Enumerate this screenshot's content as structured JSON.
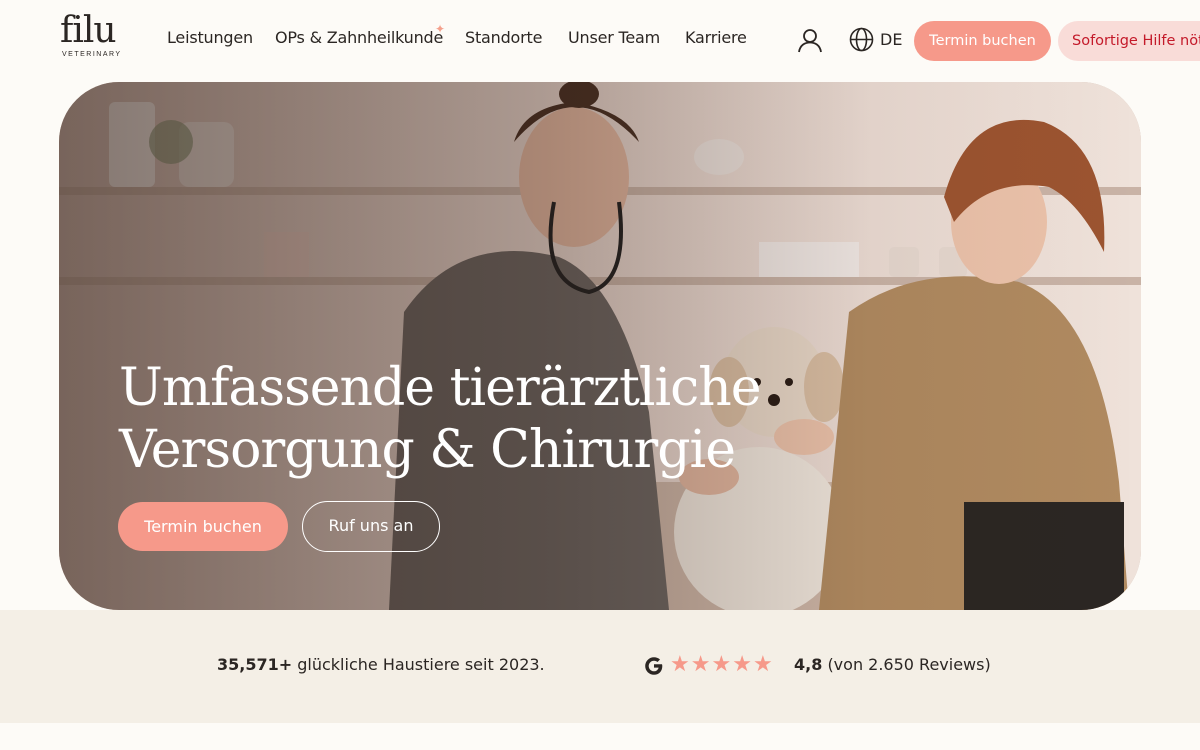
{
  "brand": {
    "logo_word": "filu",
    "logo_sub": "VETERINARY"
  },
  "nav": {
    "items": [
      {
        "label": "Leistungen"
      },
      {
        "label": "OPs & Zahnheilkunde"
      },
      {
        "label": "Standorte"
      },
      {
        "label": "Unser Team"
      },
      {
        "label": "Karriere"
      }
    ],
    "sparkle_glyph": "✦"
  },
  "header": {
    "language": "DE",
    "book_label": "Termin buchen",
    "help_label": "Sofortige Hilfe nötig"
  },
  "hero": {
    "title_line1": "Umfassende tierärztliche",
    "title_line2": "Versorgung & Chirurgie",
    "book_label": "Termin buchen",
    "call_label": "Ruf uns an"
  },
  "stats": {
    "pets_count": "35,571+",
    "pets_text": "glückliche Haustiere seit 2023.",
    "rating_value": "4,8",
    "rating_text": "(von 2.650 Reviews)",
    "stars": 5
  },
  "colors": {
    "accent": "#f6998a",
    "help_bg": "#f9dcd8",
    "help_text": "#c41a2a",
    "strip_bg": "#f4efe6",
    "page_bg": "#fdfbf7"
  },
  "icons": {
    "user": "user-icon",
    "globe": "globe-icon",
    "google": "google-icon",
    "star": "star-icon"
  }
}
